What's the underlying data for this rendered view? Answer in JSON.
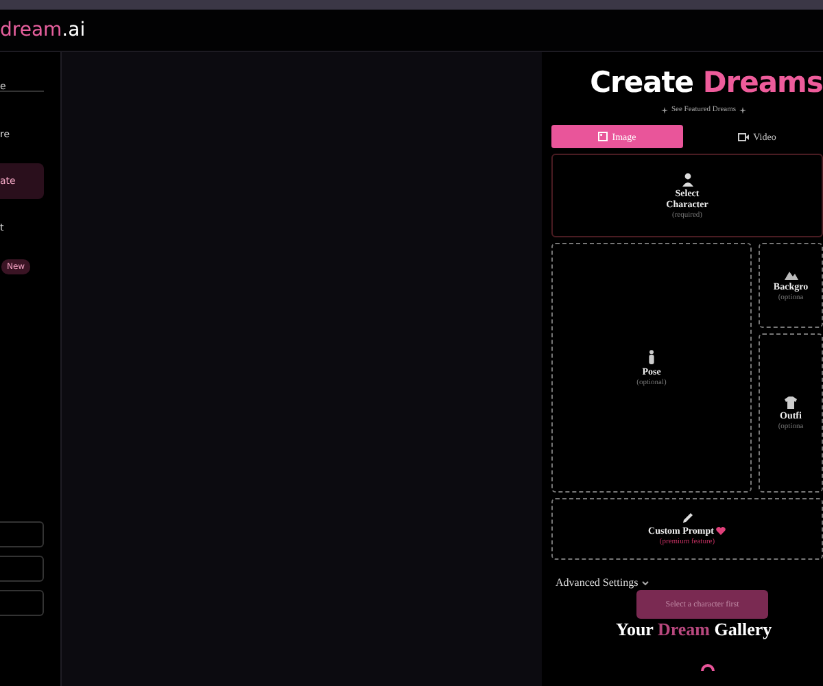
{
  "header": {
    "logo_accent": "dream",
    "logo_rest": ".ai"
  },
  "sidebar": {
    "items": [
      {
        "label": "e",
        "selected": false
      },
      {
        "label": "re",
        "selected": false
      },
      {
        "label": "ate",
        "selected": true
      },
      {
        "label": "t",
        "selected": false
      }
    ],
    "badge": "New"
  },
  "create": {
    "title": "Create",
    "title_accent": "Dreams",
    "featured_link": "See Featured Dreams",
    "tabs": [
      {
        "label": "Image",
        "selected": true
      },
      {
        "label": "Video",
        "selected": false
      }
    ],
    "cards": [
      {
        "kind": "character",
        "title": "Select Character",
        "note": "(required)"
      },
      {
        "kind": "pose",
        "title": "Pose",
        "note": "(optional)"
      },
      {
        "kind": "background",
        "title": "Backgro",
        "note": "(optiona"
      },
      {
        "kind": "outfit",
        "title": "Outfi",
        "note": "(optiona"
      },
      {
        "kind": "prompt",
        "title": "Custom Prompt",
        "note": "(premium feature)",
        "premium": true
      }
    ],
    "advanced": {
      "label": "Advanced Settings",
      "expanded": false
    },
    "generate_button": {
      "label": "Select a character first",
      "disabled": true
    },
    "gallery": {
      "before": "Your",
      "accent": "Dream",
      "after": "Gallery"
    }
  }
}
